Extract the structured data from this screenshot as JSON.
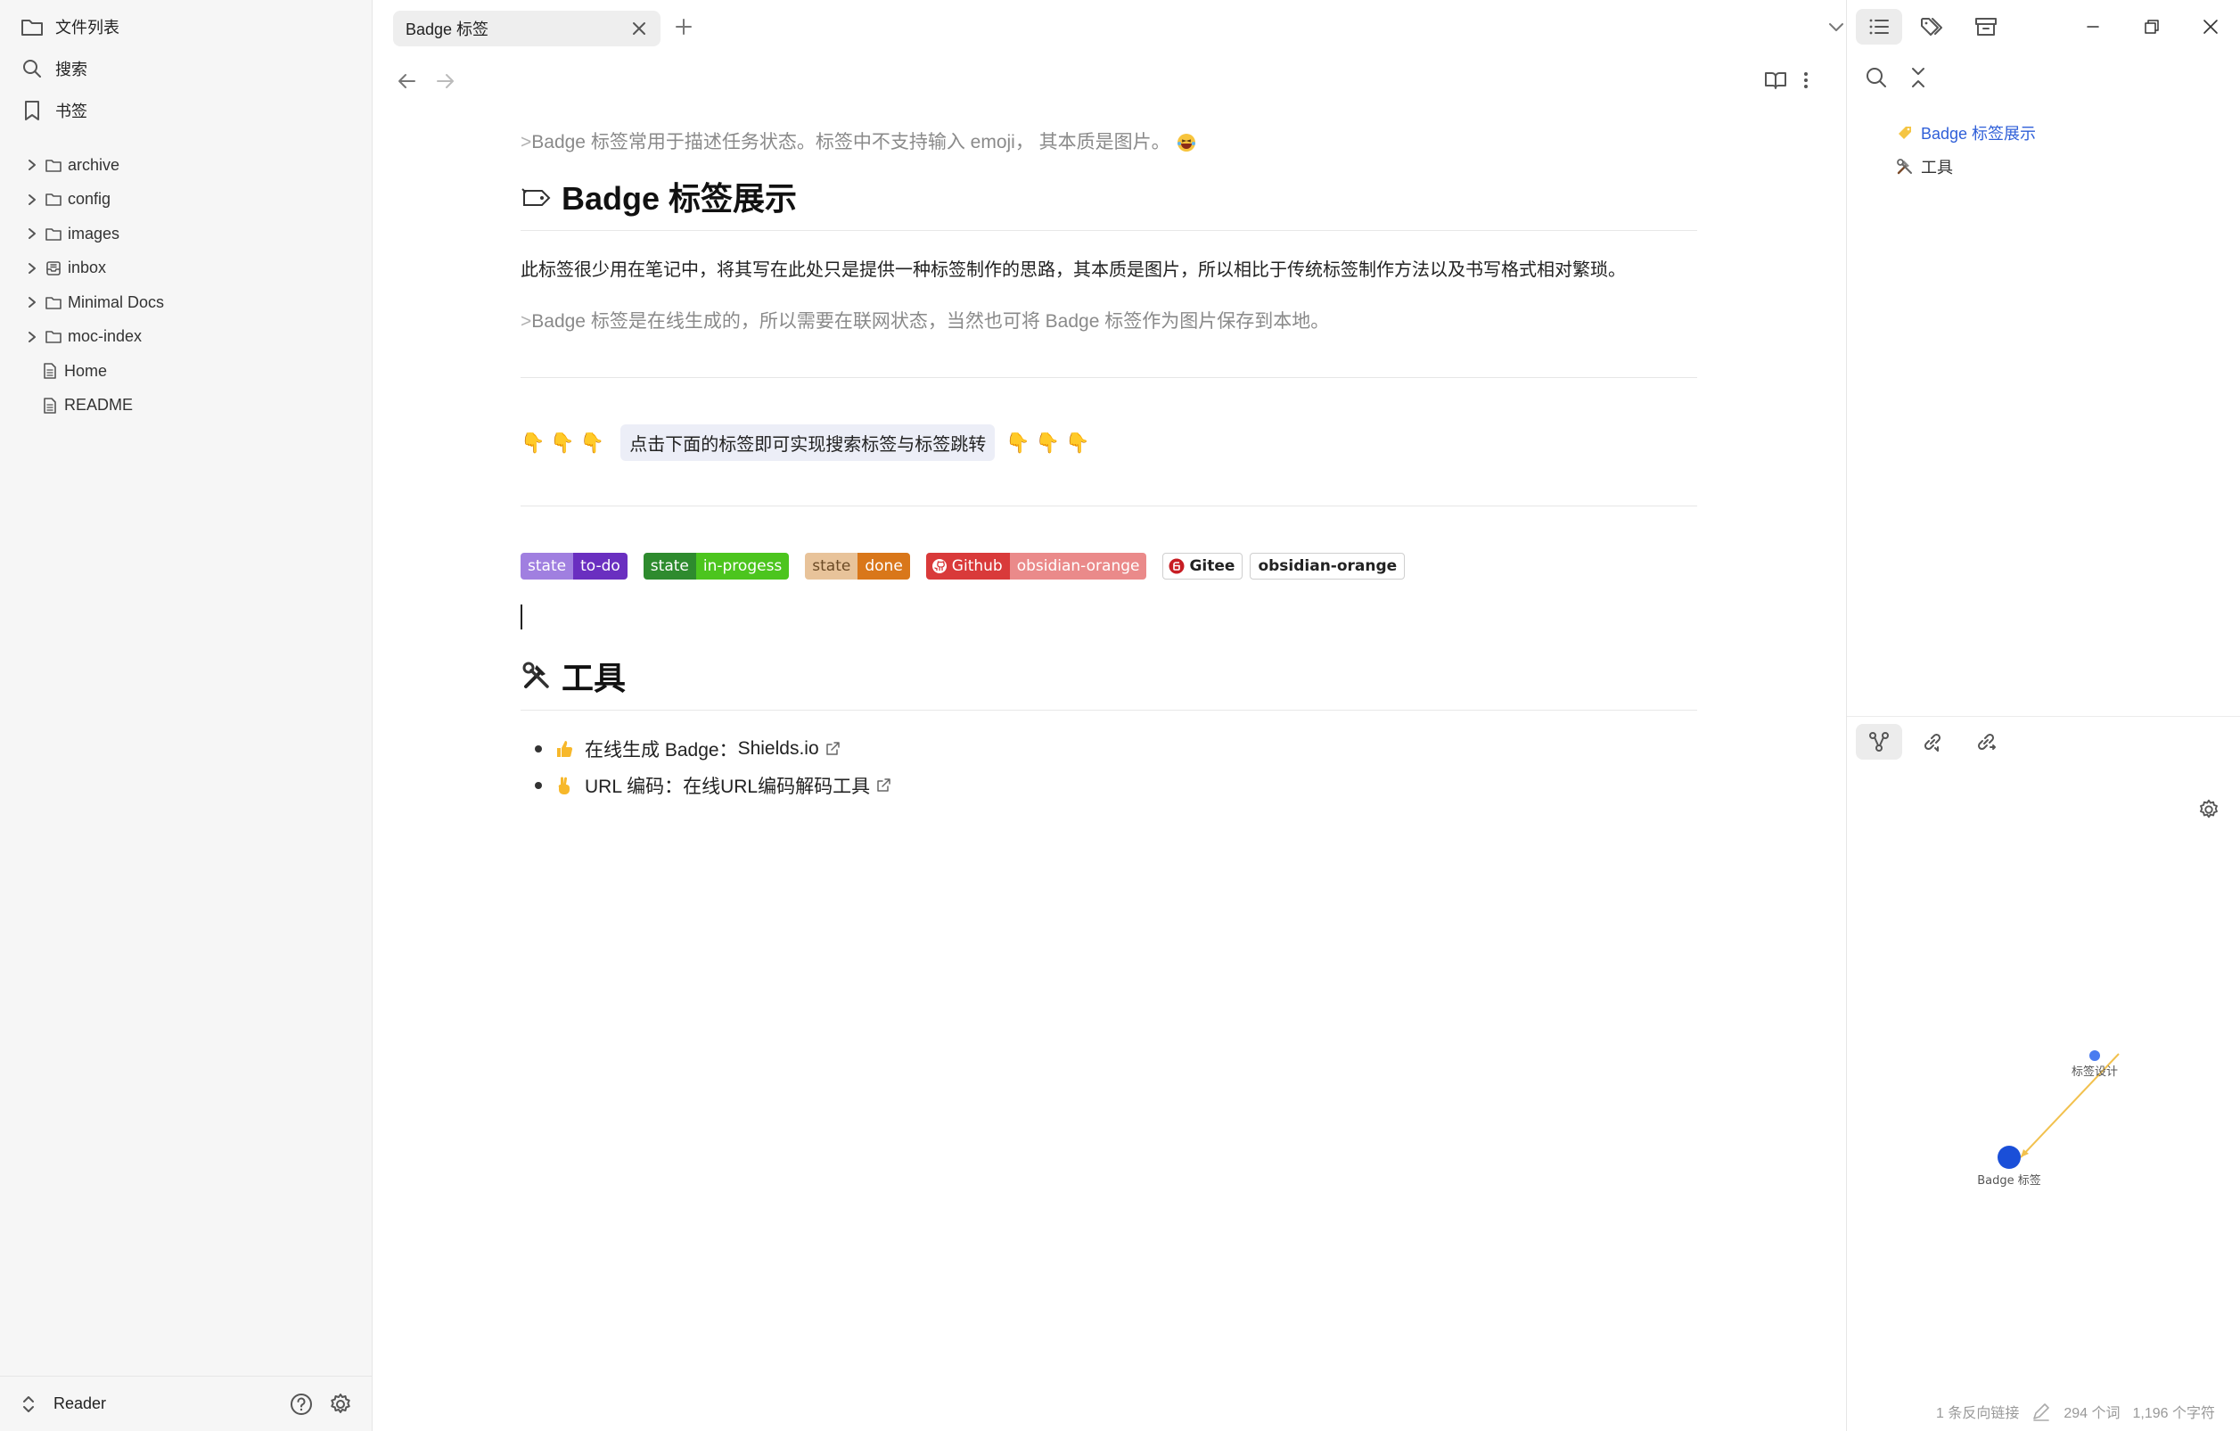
{
  "sidebar": {
    "file_list": "文件列表",
    "search": "搜索",
    "bookmarks": "书签",
    "tree": [
      {
        "label": "archive",
        "type": "folder"
      },
      {
        "label": "config",
        "type": "folder"
      },
      {
        "label": "images",
        "type": "folder"
      },
      {
        "label": "inbox",
        "type": "inbox"
      },
      {
        "label": "Minimal Docs",
        "type": "folder"
      },
      {
        "label": "moc-index",
        "type": "folder"
      },
      {
        "label": "Home",
        "type": "file"
      },
      {
        "label": "README",
        "type": "file"
      }
    ],
    "vault_name": "Reader"
  },
  "tabs": {
    "active_title": "Badge 标签"
  },
  "note": {
    "quote1_marker": ">",
    "quote1_text": "Badge 标签常用于描述任务状态。标签中不支持输入 emoji， 其本质是图片。",
    "h2_showcase": "Badge 标签展示",
    "para1": "此标签很少用在笔记中，将其写在此处只是提供一种标签制作的思路，其本质是图片，所以相比于传统标签制作方法以及书写格式相对繁琐。",
    "quote2_marker": ">",
    "quote2_text": "Badge 标签是在线生成的，所以需要在联网状态，当然也可将 Badge 标签作为图片保存到本地。",
    "hint_text": "点击下面的标签即可实现搜索标签与标签跳转",
    "badges": [
      {
        "left": "state",
        "right": "to-do",
        "left_color": "#a07fe0",
        "right_color": "#6a2fc0"
      },
      {
        "left": "state",
        "right": "in-progess",
        "left_color": "#2e8b2e",
        "right_color": "#4cc51e"
      },
      {
        "left": "state",
        "right": "done",
        "left_color": "#e8c39a",
        "right_color": "#d9771a"
      },
      {
        "left": "Github",
        "right": "obsidian-orange",
        "left_color": "#d93a3a",
        "right_color": "#ea8a8a"
      },
      {
        "left": "Gitee",
        "right": "obsidian-orange",
        "left_color": "#ffffff",
        "right_color": "#ffffff"
      }
    ],
    "h2_tools": "工具",
    "links": [
      {
        "prefix": "在线生成 Badge：",
        "link": "Shields.io"
      },
      {
        "prefix": "URL 编码：",
        "link": "在线URL编码解码工具"
      }
    ]
  },
  "outline": {
    "items": [
      "Badge 标签展示",
      "工具"
    ]
  },
  "graph": {
    "node_current": "Badge 标签",
    "node_linked": "标签设计",
    "current_color": "#1a4fd8",
    "linked_color": "#4a7cf0",
    "edge_color": "#f2c14e"
  },
  "status": {
    "backlinks": "1 条反向链接",
    "words": "294 个词",
    "chars": "1,196 个字符"
  }
}
